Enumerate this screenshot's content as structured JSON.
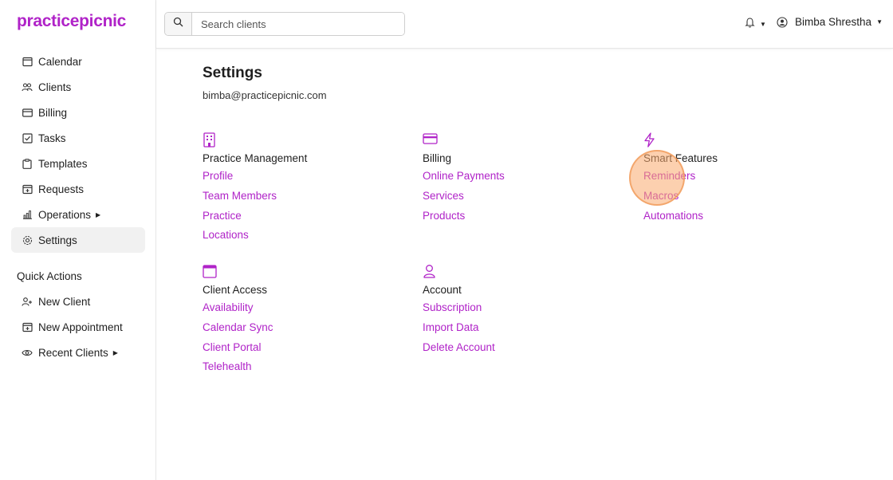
{
  "brand": {
    "name": "practicepicnic"
  },
  "sidebar": {
    "items": [
      {
        "label": "Calendar",
        "icon": "calendar-icon"
      },
      {
        "label": "Clients",
        "icon": "users-icon"
      },
      {
        "label": "Billing",
        "icon": "credit-card-icon"
      },
      {
        "label": "Tasks",
        "icon": "checkbox-icon"
      },
      {
        "label": "Templates",
        "icon": "clipboard-icon"
      },
      {
        "label": "Requests",
        "icon": "calendar-plus-icon"
      },
      {
        "label": "Operations",
        "icon": "bar-chart-icon"
      },
      {
        "label": "Settings",
        "icon": "gear-icon"
      }
    ],
    "quick_actions_title": "Quick Actions",
    "quick_actions": [
      {
        "label": "New Client",
        "icon": "user-plus-icon"
      },
      {
        "label": "New Appointment",
        "icon": "calendar-plus-icon"
      },
      {
        "label": "Recent Clients",
        "icon": "eye-icon"
      }
    ]
  },
  "header": {
    "search_placeholder": "Search clients",
    "user_name": "Bimba Shrestha"
  },
  "main": {
    "title": "Settings",
    "email": "bimba@practicepicnic.com",
    "sections": [
      {
        "title": "Practice Management",
        "icon": "building-icon",
        "links": [
          "Profile",
          "Team Members",
          "Practice",
          "Locations"
        ]
      },
      {
        "title": "Billing",
        "icon": "credit-card-icon",
        "links": [
          "Online Payments",
          "Services",
          "Products"
        ]
      },
      {
        "title": "Smart Features",
        "icon": "lightning-icon",
        "links": [
          "Reminders",
          "Macros",
          "Automations"
        ]
      },
      {
        "title": "Client Access",
        "icon": "calendar-icon",
        "links": [
          "Availability",
          "Calendar Sync",
          "Client Portal",
          "Telehealth"
        ]
      },
      {
        "title": "Account",
        "icon": "user-icon",
        "links": [
          "Subscription",
          "Import Data",
          "Delete Account"
        ]
      }
    ]
  },
  "colors": {
    "accent": "#b023c8",
    "highlight": "#f6a86e",
    "active_bg": "#f1f1f1"
  }
}
